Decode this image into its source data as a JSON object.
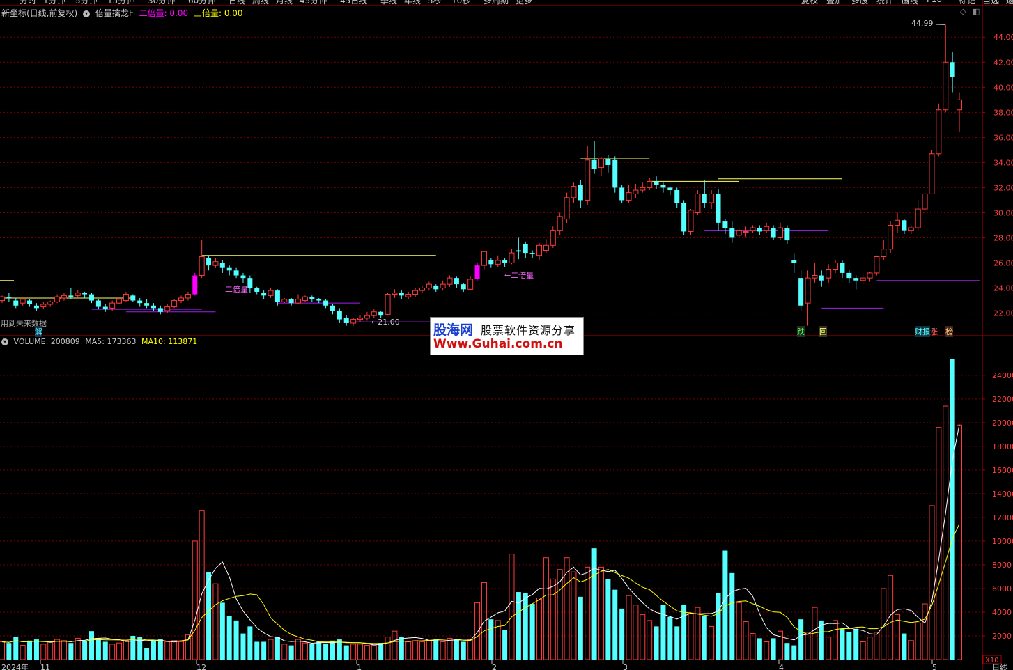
{
  "toolbar": {
    "items": [
      "分时",
      "1分钟",
      "5分钟",
      "15分钟",
      "30分钟",
      "60分钟",
      "日线",
      "周线",
      "月线",
      "45分钟",
      "45日线",
      "季线",
      "年线",
      "5秒",
      "10秒",
      "多周期",
      "更多",
      "复权",
      "叠加",
      "多股",
      "统计",
      "画线",
      "F10",
      "标记",
      "自选",
      "返回"
    ]
  },
  "main_header": {
    "title": "新坐标(日线,前复权)",
    "indicator": "倍量擒龙F",
    "double_label": "二倍量: 0.00",
    "triple_label": "三倍量: 0.00",
    "colors": {
      "title": "#c8c8c8",
      "indicator": "#c8c8c8",
      "double": "#ff00ff",
      "triple": "#ffff00"
    }
  },
  "volume_header": {
    "volume": "VOLUME: 200809",
    "ma5": "MA5: 173363",
    "ma10": "MA10: 113871",
    "colors": {
      "volume": "#c8c8c8",
      "ma5": "#ffffff",
      "ma10": "#ffff00"
    }
  },
  "annotations": {
    "future_data": "用到未来数据",
    "jie": "解",
    "double_vol_1": "二倍量",
    "double_vol_2": "←二倍量",
    "low_price": "←21.00",
    "high_price": "44.99",
    "die": "跌",
    "hui": "回",
    "caibao": "财报",
    "zhang": "涨",
    "bang": "榜"
  },
  "price_axis": {
    "ticks": [
      "44.00",
      "42.00",
      "40.00",
      "38.00",
      "36.00",
      "34.00",
      "32.00",
      "30.00",
      "28.00",
      "26.00",
      "24.00",
      "22.00"
    ]
  },
  "volume_axis": {
    "ticks": [
      "24000",
      "22000",
      "20000",
      "18000",
      "16000",
      "14000",
      "12000",
      "10000",
      "8000",
      "6000",
      "4000",
      "2000"
    ],
    "unit": "X10"
  },
  "x_axis": {
    "labels": [
      "2024年",
      "11",
      "12",
      "1",
      "2",
      "3",
      "4",
      "5",
      "日线"
    ]
  },
  "watermark": {
    "brand": "股海网",
    "slogan": "股票软件资源分享",
    "url": "Www.Guhai.com.cn"
  },
  "colors": {
    "up": "#ff3b3b",
    "down": "#54ffff",
    "double_volume": "#ff00ff",
    "ma5": "#ffffff",
    "ma10": "#ffff00",
    "grid": "#7a0000",
    "axis_border": "#b00000",
    "support_line": "#a020f0",
    "resistance_line": "#ffff66"
  },
  "chart_data": {
    "type": "candlestick",
    "ylim_price": [
      21,
      45
    ],
    "ylim_volume": [
      0,
      25500
    ],
    "candles": [
      [
        23.0,
        23.3,
        22.8,
        23.4,
        1500
      ],
      [
        23.3,
        23.2,
        22.9,
        23.6,
        1400
      ],
      [
        23.0,
        22.6,
        22.4,
        23.2,
        1900
      ],
      [
        22.8,
        23.1,
        22.6,
        23.3,
        1200
      ],
      [
        23.0,
        22.7,
        22.5,
        23.1,
        1600
      ],
      [
        22.6,
        22.4,
        22.2,
        22.8,
        1700
      ],
      [
        22.5,
        22.7,
        22.3,
        22.9,
        1300
      ],
      [
        22.7,
        22.9,
        22.5,
        23.0,
        1500
      ],
      [
        22.9,
        23.3,
        22.8,
        23.5,
        1700
      ],
      [
        23.2,
        23.4,
        23.0,
        23.6,
        1600
      ],
      [
        23.4,
        23.3,
        23.1,
        24.0,
        1400
      ],
      [
        23.4,
        23.6,
        23.2,
        23.8,
        1800
      ],
      [
        23.6,
        23.5,
        23.2,
        23.7,
        1600
      ],
      [
        23.5,
        23.0,
        22.8,
        23.6,
        2400
      ],
      [
        23.0,
        22.5,
        22.3,
        23.1,
        1800
      ],
      [
        22.5,
        22.3,
        22.1,
        22.7,
        1500
      ],
      [
        22.4,
        22.8,
        22.2,
        23.0,
        1300
      ],
      [
        22.8,
        23.1,
        22.7,
        23.2,
        1400
      ],
      [
        23.0,
        23.5,
        22.9,
        23.7,
        1600
      ],
      [
        23.4,
        23.0,
        22.9,
        23.5,
        2000
      ],
      [
        23.0,
        22.8,
        22.5,
        23.2,
        1900
      ],
      [
        22.8,
        22.6,
        22.4,
        23.1,
        1000
      ],
      [
        22.6,
        22.4,
        22.2,
        22.8,
        1600
      ],
      [
        22.4,
        22.1,
        21.9,
        22.6,
        1700
      ],
      [
        22.2,
        22.5,
        22.0,
        22.7,
        1500
      ],
      [
        22.5,
        23.0,
        22.4,
        23.1,
        1600
      ],
      [
        23.0,
        23.2,
        22.8,
        23.4,
        1500
      ],
      [
        23.2,
        23.5,
        23.0,
        23.7,
        2100
      ],
      [
        23.5,
        25.0,
        23.4,
        25.2,
        10000
      ],
      [
        25.0,
        26.5,
        24.8,
        27.8,
        12600
      ],
      [
        26.4,
        25.8,
        25.4,
        26.6,
        7400
      ],
      [
        25.8,
        26.1,
        25.6,
        26.4,
        6400
      ],
      [
        26.0,
        25.6,
        25.2,
        26.2,
        4800
      ],
      [
        25.6,
        25.4,
        25.0,
        25.8,
        3700
      ],
      [
        25.4,
        25.0,
        24.8,
        25.6,
        3300
      ],
      [
        25.0,
        24.8,
        24.4,
        25.2,
        2200
      ],
      [
        24.8,
        24.0,
        23.6,
        25.0,
        2800
      ],
      [
        24.0,
        23.7,
        23.5,
        24.1,
        1500
      ],
      [
        23.6,
        23.4,
        23.1,
        23.8,
        1500
      ],
      [
        23.4,
        23.8,
        23.2,
        24.0,
        1700
      ],
      [
        23.8,
        22.9,
        22.6,
        23.9,
        1900
      ],
      [
        22.9,
        23.1,
        22.8,
        23.2,
        1300
      ],
      [
        23.1,
        22.8,
        22.6,
        23.2,
        1200
      ],
      [
        22.8,
        23.1,
        22.7,
        23.5,
        1700
      ],
      [
        23.0,
        23.3,
        22.9,
        23.4,
        1400
      ],
      [
        23.3,
        23.1,
        22.9,
        23.4,
        1300
      ],
      [
        23.1,
        23.0,
        22.8,
        23.2,
        1500
      ],
      [
        23.0,
        22.6,
        22.4,
        23.1,
        1300
      ],
      [
        22.6,
        22.2,
        21.9,
        22.7,
        1600
      ],
      [
        22.2,
        21.5,
        21.2,
        22.4,
        1700
      ],
      [
        21.6,
        21.2,
        21.0,
        21.8,
        1200
      ],
      [
        21.2,
        21.5,
        21.0,
        21.6,
        1300
      ],
      [
        21.5,
        21.6,
        21.3,
        21.8,
        1300
      ],
      [
        21.6,
        21.8,
        21.4,
        22.1,
        1200
      ],
      [
        21.8,
        22.1,
        21.6,
        22.3,
        1200
      ],
      [
        22.1,
        21.8,
        21.6,
        22.2,
        1400
      ],
      [
        21.9,
        23.5,
        21.8,
        23.6,
        1900
      ],
      [
        23.5,
        23.6,
        23.2,
        23.9,
        2400
      ],
      [
        23.6,
        23.4,
        23.1,
        23.8,
        1900
      ],
      [
        23.3,
        23.5,
        23.1,
        23.7,
        1500
      ],
      [
        23.5,
        23.8,
        23.3,
        24.0,
        1600
      ],
      [
        23.8,
        24.0,
        23.6,
        24.2,
        1500
      ],
      [
        24.0,
        24.3,
        23.8,
        24.5,
        1600
      ],
      [
        24.2,
        23.9,
        23.7,
        24.3,
        1700
      ],
      [
        24.0,
        24.3,
        23.8,
        24.6,
        1500
      ],
      [
        24.3,
        24.8,
        24.1,
        25.0,
        1800
      ],
      [
        24.8,
        24.3,
        24.0,
        24.9,
        1700
      ],
      [
        24.3,
        23.9,
        23.7,
        24.4,
        1500
      ],
      [
        23.9,
        24.7,
        23.8,
        24.9,
        1700
      ],
      [
        24.7,
        25.8,
        24.6,
        26.0,
        4800
      ],
      [
        25.8,
        26.9,
        25.5,
        26.9,
        6500
      ],
      [
        26.2,
        25.9,
        25.6,
        26.4,
        3400
      ],
      [
        25.9,
        26.2,
        25.7,
        26.6,
        3300
      ],
      [
        26.2,
        26.0,
        25.7,
        26.4,
        2500
      ],
      [
        26.0,
        26.8,
        25.9,
        27.1,
        8900
      ],
      [
        27.0,
        26.9,
        26.3,
        28.0,
        5700
      ],
      [
        27.5,
        26.8,
        26.4,
        27.7,
        5600
      ],
      [
        26.8,
        26.7,
        26.4,
        27.0,
        4700
      ],
      [
        26.6,
        27.4,
        26.2,
        27.6,
        5200
      ],
      [
        27.0,
        27.4,
        26.8,
        27.9,
        8600
      ],
      [
        27.4,
        28.6,
        27.2,
        28.9,
        6800
      ],
      [
        28.6,
        29.7,
        28.2,
        30.0,
        7600
      ],
      [
        29.5,
        31.2,
        29.2,
        31.6,
        8600
      ],
      [
        31.2,
        32.1,
        30.8,
        32.4,
        7400
      ],
      [
        32.2,
        31.0,
        30.4,
        32.6,
        5300
      ],
      [
        31.0,
        34.2,
        30.6,
        35.3,
        7800
      ],
      [
        34.2,
        33.5,
        33.1,
        35.7,
        9400
      ],
      [
        33.6,
        34.3,
        32.9,
        34.4,
        7800
      ],
      [
        34.3,
        33.8,
        33.2,
        34.6,
        6800
      ],
      [
        34.2,
        32.0,
        31.6,
        34.5,
        5900
      ],
      [
        32.0,
        31.0,
        30.8,
        32.2,
        4300
      ],
      [
        31.0,
        31.6,
        30.8,
        32.2,
        5400
      ],
      [
        31.5,
        31.8,
        31.2,
        32.3,
        4600
      ],
      [
        31.8,
        32.0,
        31.6,
        32.4,
        3800
      ],
      [
        32.0,
        32.5,
        31.8,
        32.8,
        3300
      ],
      [
        32.5,
        32.2,
        31.9,
        32.9,
        2800
      ],
      [
        32.2,
        32.0,
        31.6,
        32.4,
        4600
      ],
      [
        32.0,
        31.8,
        31.4,
        32.1,
        3600
      ],
      [
        31.8,
        30.8,
        30.4,
        32.0,
        2800
      ],
      [
        30.8,
        28.5,
        28.2,
        31.0,
        4600
      ],
      [
        28.5,
        30.2,
        28.2,
        30.3,
        3900
      ],
      [
        30.0,
        31.5,
        29.8,
        31.8,
        4400
      ],
      [
        31.5,
        30.8,
        30.4,
        32.6,
        3700
      ],
      [
        30.8,
        31.5,
        30.3,
        31.8,
        2800
      ],
      [
        31.5,
        29.2,
        28.6,
        31.9,
        5600
      ],
      [
        29.3,
        28.8,
        28.3,
        29.5,
        9200
      ],
      [
        28.8,
        28.0,
        27.6,
        29.3,
        7300
      ],
      [
        28.2,
        28.6,
        28.0,
        28.8,
        4800
      ],
      [
        28.5,
        28.5,
        28.1,
        28.9,
        3200
      ],
      [
        28.6,
        28.8,
        28.4,
        29.0,
        2200
      ],
      [
        28.8,
        28.5,
        28.2,
        29.0,
        1800
      ],
      [
        28.6,
        28.9,
        28.4,
        29.2,
        1500
      ],
      [
        28.8,
        28.0,
        27.8,
        29.0,
        1800
      ],
      [
        28.0,
        28.8,
        27.8,
        29.2,
        2400
      ],
      [
        28.8,
        27.8,
        27.5,
        29.0,
        1400
      ],
      [
        26.2,
        26.0,
        25.2,
        26.8,
        1200
      ],
      [
        24.8,
        22.6,
        22.2,
        25.4,
        3400
      ],
      [
        22.8,
        24.8,
        21.0,
        25.4,
        2300
      ],
      [
        24.8,
        25.0,
        24.4,
        26.0,
        4400
      ],
      [
        25.0,
        24.6,
        24.1,
        25.4,
        3300
      ],
      [
        24.8,
        25.5,
        24.4,
        25.9,
        1900
      ],
      [
        25.5,
        26.0,
        25.2,
        26.2,
        3300
      ],
      [
        26.0,
        25.2,
        24.8,
        26.2,
        2600
      ],
      [
        25.2,
        24.8,
        24.4,
        25.4,
        2300
      ],
      [
        24.8,
        24.6,
        23.9,
        25.0,
        2600
      ],
      [
        24.6,
        24.8,
        24.3,
        25.1,
        1500
      ],
      [
        24.8,
        25.2,
        24.5,
        25.3,
        1900
      ],
      [
        25.2,
        26.5,
        25.0,
        26.6,
        2300
      ],
      [
        26.5,
        27.1,
        26.2,
        27.8,
        6000
      ],
      [
        27.1,
        29.0,
        26.8,
        29.3,
        7100
      ],
      [
        29.0,
        29.4,
        28.4,
        30.0,
        3800
      ],
      [
        29.4,
        28.6,
        28.3,
        29.5,
        2200
      ],
      [
        28.6,
        28.8,
        28.3,
        29.0,
        1600
      ],
      [
        28.8,
        30.3,
        28.6,
        31.0,
        3100
      ],
      [
        30.3,
        31.5,
        30.0,
        31.8,
        4700
      ],
      [
        31.5,
        34.7,
        31.5,
        35.0,
        13000
      ],
      [
        34.7,
        38.2,
        34.5,
        38.7,
        19600
      ],
      [
        38.2,
        42.0,
        38.0,
        44.99,
        21400
      ],
      [
        42.0,
        40.8,
        39.6,
        42.8,
        25400
      ],
      [
        38.2,
        39.0,
        36.4,
        39.6,
        19800
      ]
    ]
  }
}
